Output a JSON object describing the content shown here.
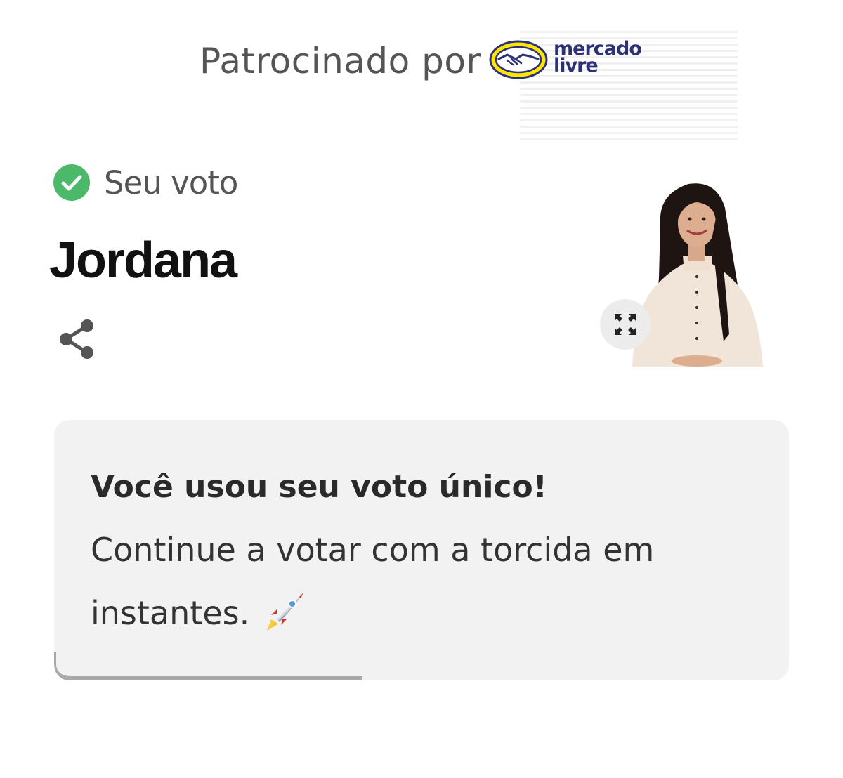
{
  "sponsor": {
    "label": "Patrocinado por",
    "brand_line1": "mercado",
    "brand_line2": "livre",
    "brand_color": "#2d3277",
    "brand_yellow": "#ffe600"
  },
  "vote": {
    "label": "Seu voto",
    "candidate": "Jordana",
    "check_color": "#4cb96a"
  },
  "card": {
    "title": "Você usou seu voto único!",
    "body": "Continue a votar com a torcida em instantes.",
    "emoji_icon": "rocket-icon",
    "progress_fraction": 0.42
  },
  "icons": {
    "share": "share-icon",
    "expand": "expand-icon",
    "check": "check-circle-icon"
  }
}
